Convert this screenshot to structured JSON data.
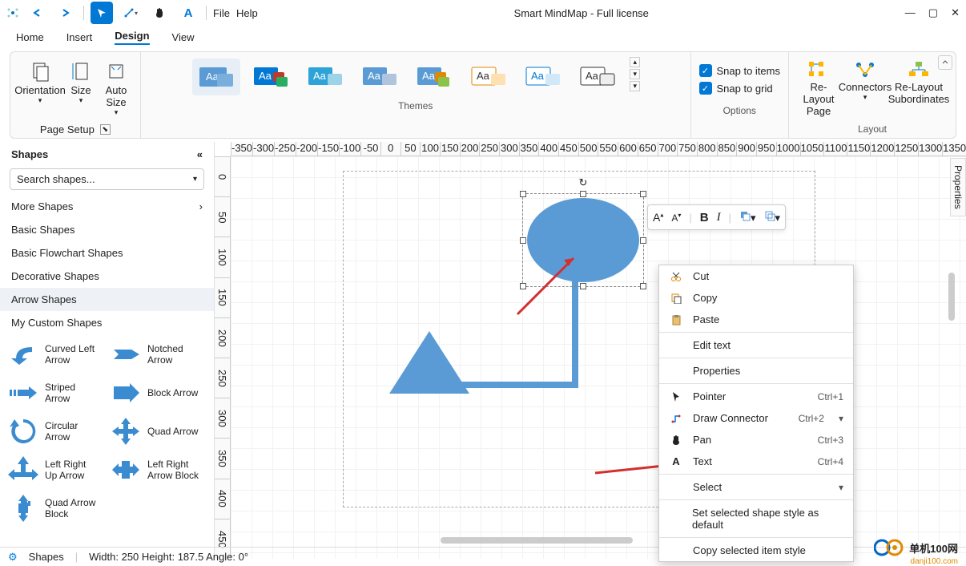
{
  "app": {
    "title": "Smart MindMap - Full license"
  },
  "titlebar": {
    "file": "File",
    "help": "Help"
  },
  "menubar": {
    "tabs": [
      "Home",
      "Insert",
      "Design",
      "View"
    ],
    "active": "Design"
  },
  "ribbon": {
    "page_setup": {
      "label": "Page Setup",
      "orientation": "Orientation",
      "size": "Size",
      "auto_size": "Auto\nSize"
    },
    "themes": {
      "label": "Themes"
    },
    "options": {
      "label": "Options",
      "snap_items": "Snap to items",
      "snap_grid": "Snap to grid"
    },
    "layout": {
      "label": "Layout",
      "relayout_page": "Re-Layout\nPage",
      "connectors": "Connectors",
      "relayout_sub": "Re-Layout\nSubordinates"
    }
  },
  "sidebar": {
    "title": "Shapes",
    "search_ph": "Search shapes...",
    "cats": [
      "More Shapes",
      "Basic Shapes",
      "Basic Flowchart Shapes",
      "Decorative Shapes",
      "Arrow Shapes",
      "My Custom Shapes"
    ],
    "shapes": [
      {
        "a": "Curved Left\nArrow",
        "b": "Notched\nArrow"
      },
      {
        "a": "Striped\nArrow",
        "b": "Block Arrow"
      },
      {
        "a": "Circular\nArrow",
        "b": "Quad Arrow"
      },
      {
        "a": "Left Right\nUp Arrow",
        "b": "Left Right\nArrow Block"
      },
      {
        "a": "Quad Arrow\nBlock",
        "b": ""
      }
    ]
  },
  "ruler_h": [
    "-350",
    "-300",
    "-250",
    "-200",
    "-150",
    "-100",
    "-50",
    "0",
    "50",
    "100",
    "150",
    "200",
    "250",
    "300",
    "350",
    "400",
    "450",
    "500",
    "550",
    "600",
    "650",
    "700",
    "750",
    "800",
    "850",
    "900",
    "950",
    "1000",
    "1050",
    "1100",
    "1150",
    "1200",
    "1250",
    "1300",
    "1350"
  ],
  "ruler_v": [
    "0",
    "50",
    "100",
    "150",
    "200",
    "250",
    "300",
    "350",
    "400",
    "450"
  ],
  "properties_tab": "Properties",
  "fmt_bar": {
    "a_plus": "A",
    "a_minus": "A",
    "bold": "B",
    "italic": "I"
  },
  "context_menu": {
    "items": [
      {
        "icon": "cut",
        "label": "Cut",
        "short": ""
      },
      {
        "icon": "copy",
        "label": "Copy",
        "short": ""
      },
      {
        "icon": "paste",
        "label": "Paste",
        "short": ""
      },
      {
        "sep": true
      },
      {
        "icon": "",
        "label": "Edit text",
        "short": ""
      },
      {
        "sep": true
      },
      {
        "icon": "",
        "label": "Properties",
        "short": ""
      },
      {
        "sep": true
      },
      {
        "icon": "pointer",
        "label": "Pointer",
        "short": "Ctrl+1"
      },
      {
        "icon": "connector",
        "label": "Draw Connector",
        "short": "Ctrl+2",
        "sub": true
      },
      {
        "icon": "pan",
        "label": "Pan",
        "short": "Ctrl+3"
      },
      {
        "icon": "text",
        "label": "Text",
        "short": "Ctrl+4"
      },
      {
        "sep": true
      },
      {
        "icon": "",
        "label": "Select",
        "short": "",
        "sub": true
      },
      {
        "sep": true
      },
      {
        "icon": "",
        "label": "Set selected shape style as default",
        "short": ""
      },
      {
        "sep": true
      },
      {
        "icon": "",
        "label": "Copy selected item style",
        "short": ""
      }
    ]
  },
  "statusbar": {
    "shapes": "Shapes",
    "info": "Width: 250  Height: 187.5  Angle: 0°"
  },
  "watermark": {
    "main": "单机100网",
    "sub": "danji100.com"
  }
}
